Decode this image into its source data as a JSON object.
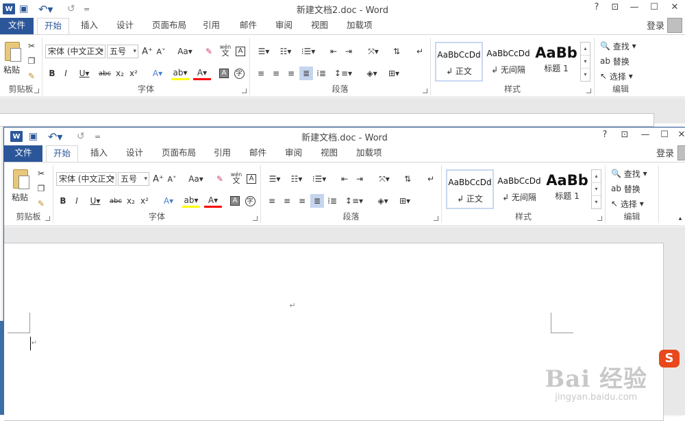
{
  "windows": [
    {
      "title": "新建文档2.doc - Word"
    },
    {
      "title": "新建文档.doc - Word"
    }
  ],
  "titlebar": {
    "help": "?",
    "restore_ribbon": "⊡",
    "minimize": "—",
    "maximize": "☐",
    "close": "✕",
    "undo_icon": "↶",
    "redo_icon": "↺",
    "save_icon": "💾",
    "more_icon": "="
  },
  "tabs": [
    "文件",
    "开始",
    "插入",
    "设计",
    "页面布局",
    "引用",
    "邮件",
    "审阅",
    "视图",
    "加载项"
  ],
  "active_tab": "开始",
  "login": "登录",
  "groups": {
    "clipboard": "剪贴板",
    "font": "字体",
    "paragraph": "段落",
    "styles": "样式",
    "editing": "编辑"
  },
  "clipboard": {
    "paste": "粘贴"
  },
  "font": {
    "font_name": "宋体 (中文正文",
    "font_size": "五号",
    "grow": "A",
    "shrink": "A",
    "case": "Aa",
    "bold": "B",
    "italic": "I",
    "underline": "U",
    "strike": "abc",
    "sub": "x₂",
    "sup": "x²",
    "text_effect": "A",
    "highlight": "ab",
    "font_color": "A",
    "char_shading": "A",
    "enclose": "字",
    "phonetic_top": "wén",
    "phonetic_bottom": "文",
    "border_char": "A"
  },
  "styles": [
    {
      "preview": "AaBbCcDd",
      "name": "↲ 正文"
    },
    {
      "preview": "AaBbCcDd",
      "name": "↲ 无间隔"
    },
    {
      "preview": "AaBb",
      "name": "标题 1"
    }
  ],
  "editing": {
    "find": "查找",
    "replace": "替换",
    "select": "选择"
  },
  "document": {
    "paragraph_mark": "↵",
    "cursor_mark": "↵"
  },
  "watermark": {
    "brand": "Bai 经验",
    "url": "jingyan.baidu.com"
  },
  "sogou_icon": "S",
  "colors": {
    "accent": "#2b579a",
    "highlight": "#ffff00",
    "font_color": "#ff0000"
  }
}
